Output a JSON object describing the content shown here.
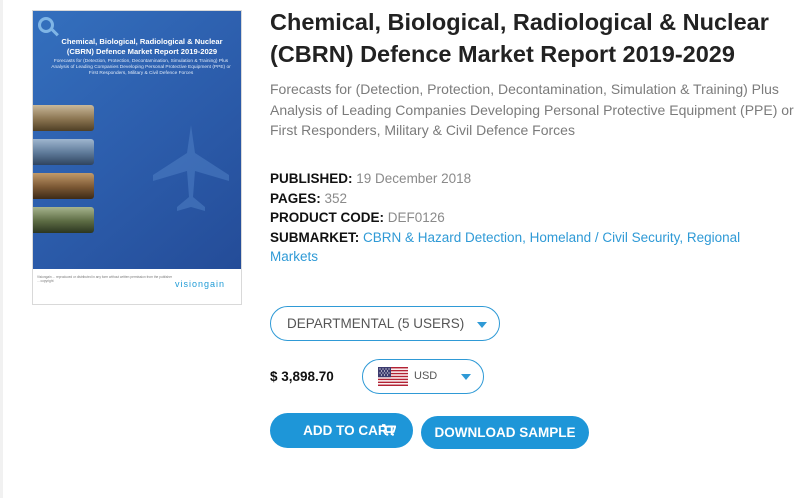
{
  "cover": {
    "title": "Chemical, Biological, Radiological & Nuclear (CBRN) Defence Market Report 2019-2029",
    "subtitle": "Forecasts for (Detection, Protection, Decontamination, Simulation & Training) Plus Analysis of Leading Companies Developing Personal Protective Equipment (PPE) or First Responders, Military & Civil Defence Forces",
    "publisher_logo": "visiongain",
    "fine_print": "Visiongain ... reproduced or distributed in any form without written permission from the publisher ... copyright"
  },
  "report": {
    "title": "Chemical, Biological, Radiological & Nuclear (CBRN) Defence Market Report 2019-2029",
    "subtitle": "Forecasts for (Detection, Protection, Decontamination, Simulation & Training) Plus Analysis of Leading Companies Developing Personal Protective Equipment (PPE) or First Responders, Military & Civil Defence Forces"
  },
  "meta": {
    "published_label": "PUBLISHED:",
    "published_value": "19 December 2018",
    "pages_label": "PAGES:",
    "pages_value": "352",
    "product_code_label": "PRODUCT CODE:",
    "product_code_value": "DEF0126",
    "submarket_label": "SUBMARKET:",
    "submarket_value": "CBRN & Hazard Detection, Homeland / Civil Security, Regional Markets"
  },
  "purchase": {
    "license_selected": "DEPARTMENTAL (5 USERS)",
    "price": "$ 3,898.70",
    "currency_selected": "USD",
    "currency_flag": "us-flag-icon",
    "add_to_cart_label": "ADD TO CART",
    "download_sample_label": "DOWNLOAD SAMPLE"
  },
  "colors": {
    "accent": "#1e96d8",
    "cover_blue": "#2d5fae",
    "title_text": "#222222",
    "muted_text": "#7b7b7b"
  }
}
